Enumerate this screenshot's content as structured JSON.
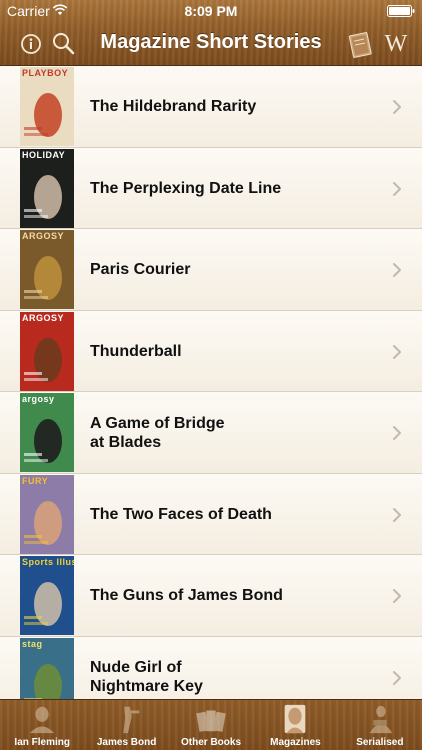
{
  "status_bar": {
    "carrier": "Carrier",
    "time": "8:09 PM"
  },
  "nav": {
    "title": "Magazine Short Stories",
    "info_icon": "info-icon",
    "search_icon": "search-icon",
    "book_icon": "book-icon",
    "wiki_icon": "wikipedia-icon",
    "wiki_letter": "W"
  },
  "stories": [
    {
      "title_lines": [
        "The Hildebrand Rarity"
      ],
      "cover_text": "PLAYBOY",
      "cover_bg": "#e9dcc0",
      "cover_fg": "#c23a2a",
      "cover_accent": "#c7492c"
    },
    {
      "title_lines": [
        "The Perplexing Date Line"
      ],
      "cover_text": "HOLIDAY",
      "cover_bg": "#1d1f1c",
      "cover_fg": "#ffffff",
      "cover_accent": "#c7b3a0"
    },
    {
      "title_lines": [
        "Paris Courier"
      ],
      "cover_text": "ARGOSY",
      "cover_bg": "#7a5a2a",
      "cover_fg": "#f2d9a6",
      "cover_accent": "#b98d3a"
    },
    {
      "title_lines": [
        "Thunderball"
      ],
      "cover_text": "ARGOSY",
      "cover_bg": "#b82a1e",
      "cover_fg": "#ffffff",
      "cover_accent": "#6e3a1d"
    },
    {
      "title_lines": [
        "A Game of Bridge",
        "at Blades"
      ],
      "cover_text": "argosy",
      "cover_bg": "#3f8a4c",
      "cover_fg": "#ffffff",
      "cover_accent": "#1e1e1e"
    },
    {
      "title_lines": [
        "The Two Faces of Death"
      ],
      "cover_text": "FURY",
      "cover_bg": "#8d7ba8",
      "cover_fg": "#f3c12f",
      "cover_accent": "#d6a07a"
    },
    {
      "title_lines": [
        "The Guns of James Bond"
      ],
      "cover_text": "Sports Illustrated",
      "cover_bg": "#1f4f8c",
      "cover_fg": "#f0d23a",
      "cover_accent": "#c4b8a6"
    },
    {
      "title_lines": [
        "Nude Girl of",
        "Nightmare Key"
      ],
      "cover_text": "stag",
      "cover_bg": "#3a6f8a",
      "cover_fg": "#f4e06a",
      "cover_accent": "#6a8c3a"
    }
  ],
  "tabs": [
    {
      "label": "Ian Fleming",
      "icon": "portrait-icon",
      "active": false
    },
    {
      "label": "James Bond",
      "icon": "gun-figure-icon",
      "active": false
    },
    {
      "label": "Other Books",
      "icon": "books-icon",
      "active": false
    },
    {
      "label": "Magazines",
      "icon": "magazine-cover-icon",
      "active": true
    },
    {
      "label": "Serialised",
      "icon": "reading-figure-icon",
      "active": false
    }
  ],
  "colors": {
    "wood_dark": "#7a4a1c",
    "wood_light": "#a9743a",
    "row_bg": "#fdfaf5",
    "chevron": "#c2b9ad"
  }
}
